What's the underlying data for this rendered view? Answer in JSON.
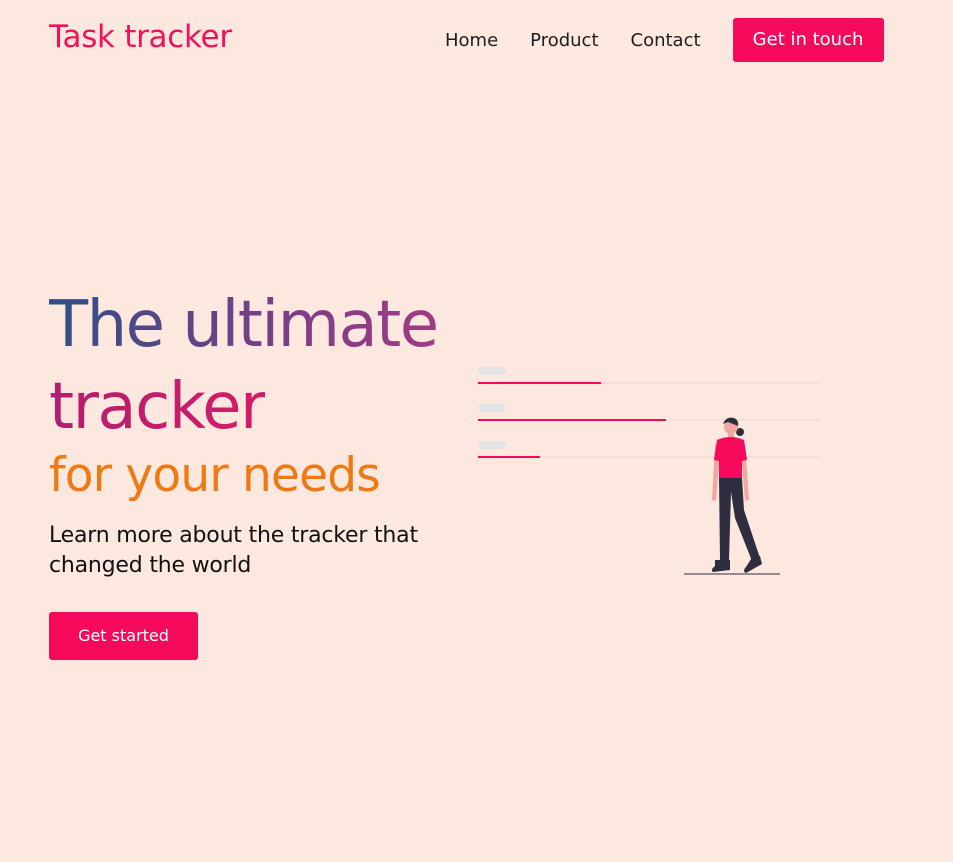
{
  "header": {
    "brand": "Task tracker",
    "nav": {
      "home": "Home",
      "product": "Product",
      "contact": "Contact"
    },
    "cta_label": "Get in touch"
  },
  "hero": {
    "line1": "The ultimate",
    "line2": "tracker",
    "line3": "for your needs",
    "subtitle": "Learn more about the tracker that changed the world",
    "cta_label": "Get started"
  },
  "illustration": {
    "progress_rows": [
      0.36,
      0.55,
      0.18
    ]
  },
  "colors": {
    "background": "#fde8e0",
    "accent": "#f5095a",
    "orange": "#ef7a14",
    "navy": "#2f2e41",
    "placeholder": "#e3e3e6"
  }
}
